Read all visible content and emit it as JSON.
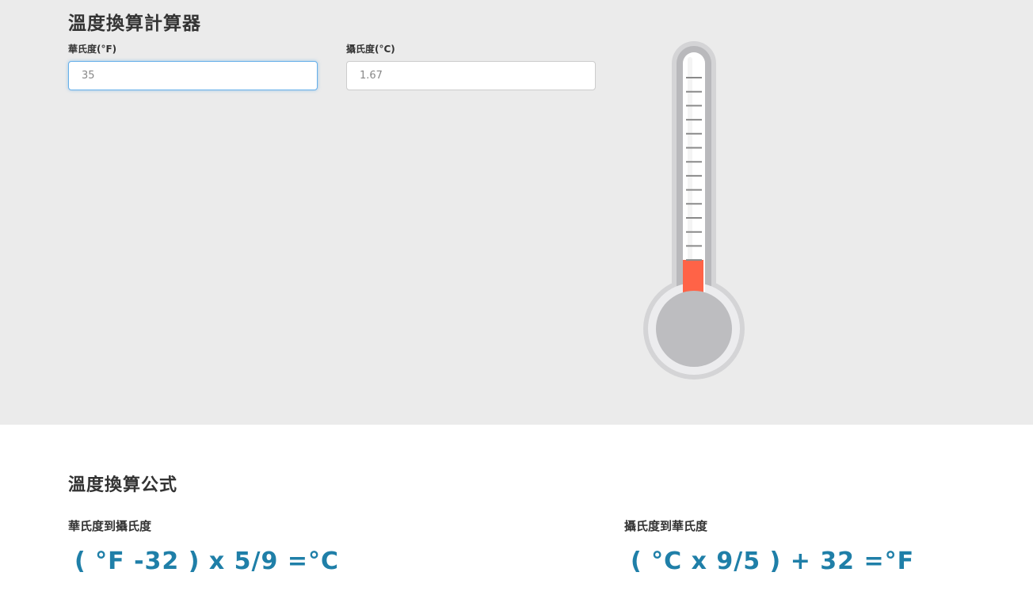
{
  "calculator": {
    "title": "溫度換算計算器",
    "fahrenheit_label": "華氏度(°F)",
    "fahrenheit_value": "35",
    "celsius_label": "攝氏度(°C)",
    "celsius_value": "1.67",
    "thermometer": {
      "mercury_color": "#ff6347",
      "tick_count": 14
    }
  },
  "formulas": {
    "title": "溫度換算公式",
    "f_to_c_label": "華氏度到攝氏度",
    "f_to_c_formula": "( °F -32 ) x 5/9 =°C",
    "c_to_f_label": "攝氏度到華氏度",
    "c_to_f_formula": "( °C x 9/5 )  + 32 =°F"
  },
  "colors": {
    "accent": "#1f7fa8",
    "panel_bg": "#ebebeb"
  }
}
